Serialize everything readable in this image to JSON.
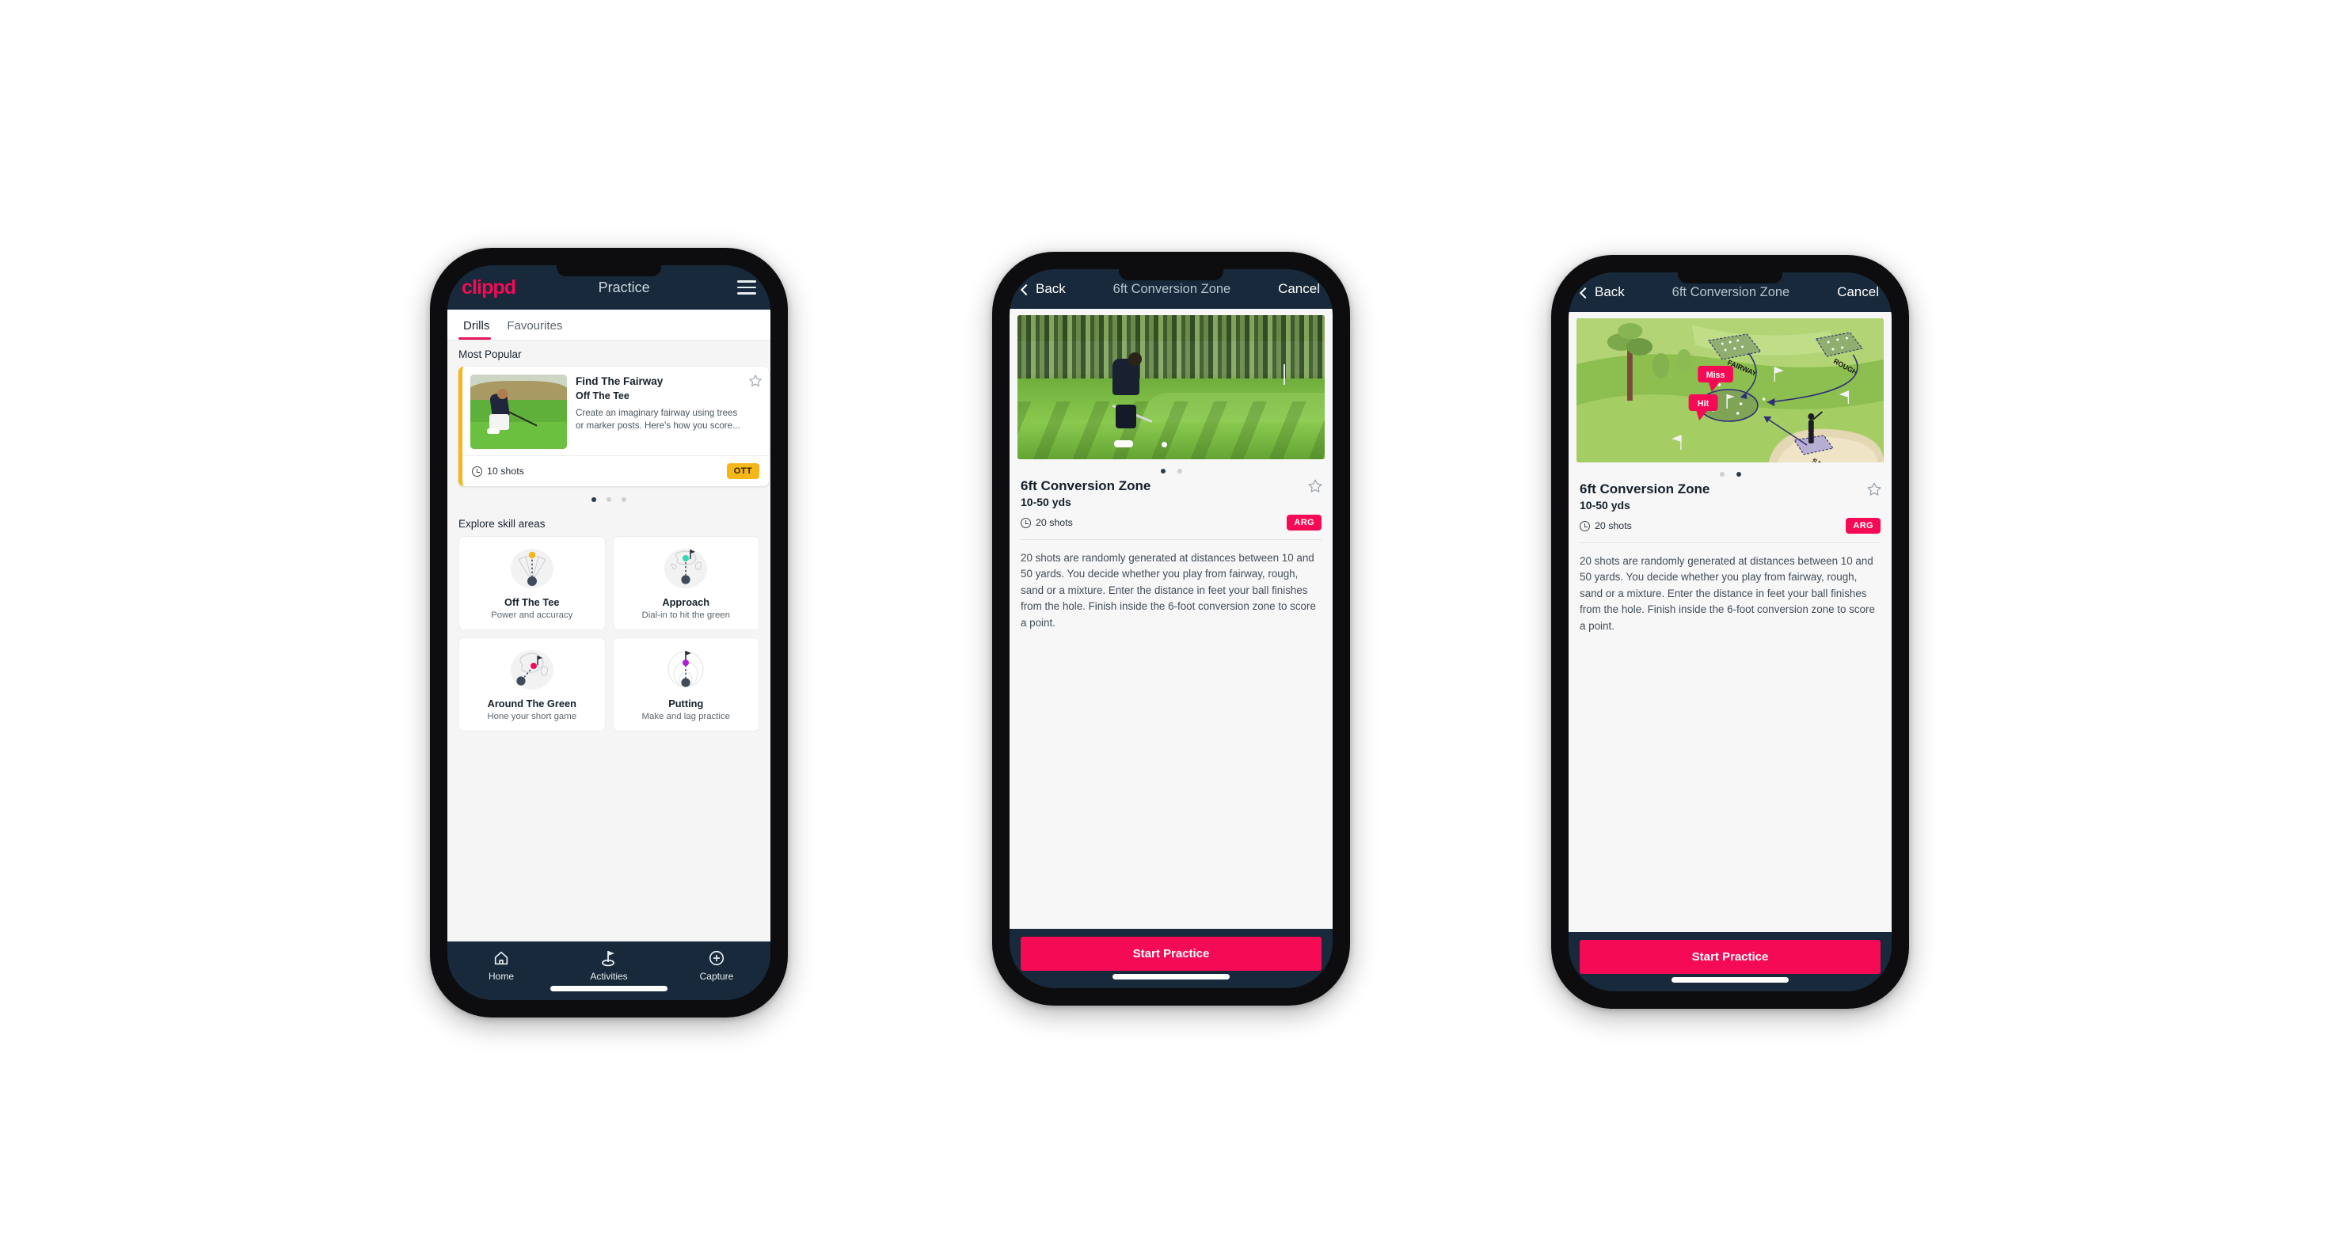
{
  "theme": {
    "brand_pink": "#f50a55",
    "header_navy": "#17293a",
    "ott_yellow": "#f5b618",
    "arg_pink": "#f50a55",
    "teal_accent": "#31d9b0"
  },
  "phone1": {
    "appbar": {
      "logo": "clippd",
      "title": "Practice",
      "menu_icon": "hamburger-menu-icon"
    },
    "tabs": [
      {
        "label": "Drills",
        "active": true
      },
      {
        "label": "Favourites",
        "active": false
      }
    ],
    "most_popular": {
      "section_label": "Most Popular",
      "card": {
        "title": "Find The Fairway",
        "subtitle": "Off The Tee",
        "description": "Create an imaginary fairway using trees or marker posts. Here's how you score...",
        "shots": "10 shots",
        "badge": "OTT",
        "badge_color": "#f5b618",
        "accent_color": "#f5b618",
        "favourite_icon": "star-outline-icon",
        "shots_icon": "clock-icon"
      },
      "dots": [
        true,
        false,
        false
      ]
    },
    "explore": {
      "section_label": "Explore skill areas",
      "skills": [
        {
          "name": "Off The Tee",
          "desc": "Power and accuracy",
          "icon": "off-the-tee-icon",
          "accent": "#f5b618"
        },
        {
          "name": "Approach",
          "desc": "Dial-in to hit the green",
          "icon": "approach-icon",
          "accent": "#31d9b0"
        },
        {
          "name": "Around The Green",
          "desc": "Hone your short game",
          "icon": "around-the-green-icon",
          "accent": "#f50a55"
        },
        {
          "name": "Putting",
          "desc": "Make and lag practice",
          "icon": "putting-icon",
          "accent": "#a821d6"
        }
      ]
    },
    "bottom_nav": [
      {
        "label": "Home",
        "icon": "home-icon",
        "active": false
      },
      {
        "label": "Activities",
        "icon": "golf-flag-icon",
        "active": true
      },
      {
        "label": "Capture",
        "icon": "plus-circle-icon",
        "active": false
      }
    ]
  },
  "phone2": {
    "navbar": {
      "back_label": "Back",
      "back_icon": "chevron-left-icon",
      "title": "6ft Conversion Zone",
      "cancel_label": "Cancel"
    },
    "media_kind": "photo",
    "media_alt": "golfer-chipping-photo",
    "dots": [
      true,
      false
    ],
    "detail": {
      "title": "6ft Conversion Zone",
      "distance": "10-50 yds",
      "shots": "20 shots",
      "badge": "ARG",
      "badge_color": "#f50a55",
      "favourite_icon": "star-outline-icon",
      "shots_icon": "clock-icon",
      "description": "20 shots are randomly generated at distances between 10 and 50 yards. You decide whether you play from fairway, rough, sand or a mixture. Enter the distance in feet your ball finishes from the hole. Finish inside the 6-foot conversion zone to score a point."
    },
    "cta_label": "Start Practice"
  },
  "phone3": {
    "navbar": {
      "back_label": "Back",
      "back_icon": "chevron-left-icon",
      "title": "6ft Conversion Zone",
      "cancel_label": "Cancel"
    },
    "media_kind": "illustration",
    "media_alt": "golf-course-diagram-illustration",
    "illustration_labels": {
      "fairway": "FAIRWAY",
      "rough": "ROUGH",
      "sand": "SAND",
      "miss": "Miss",
      "hit": "Hit"
    },
    "dots": [
      false,
      true
    ],
    "detail": {
      "title": "6ft Conversion Zone",
      "distance": "10-50 yds",
      "shots": "20 shots",
      "badge": "ARG",
      "badge_color": "#f50a55",
      "favourite_icon": "star-outline-icon",
      "shots_icon": "clock-icon",
      "description": "20 shots are randomly generated at distances between 10 and 50 yards. You decide whether you play from fairway, rough, sand or a mixture. Enter the distance in feet your ball finishes from the hole. Finish inside the 6-foot conversion zone to score a point."
    },
    "cta_label": "Start Practice"
  }
}
